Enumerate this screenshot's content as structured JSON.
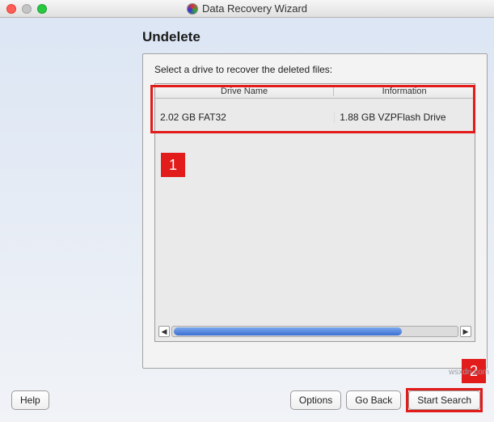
{
  "window": {
    "title": "Data Recovery Wizard"
  },
  "page": {
    "heading": "Undelete",
    "instruction": "Select a drive to recover the deleted files:"
  },
  "drive_table": {
    "headers": {
      "name": "Drive Name",
      "info": "Information"
    },
    "rows": [
      {
        "name": "2.02 GB FAT32",
        "info": "1.88 GB VZPFlash Drive"
      }
    ]
  },
  "callouts": {
    "one": "1",
    "two": "2"
  },
  "buttons": {
    "help": "Help",
    "options": "Options",
    "go_back": "Go Back",
    "start_search": "Start Search"
  },
  "watermark": "wsxdn.com"
}
